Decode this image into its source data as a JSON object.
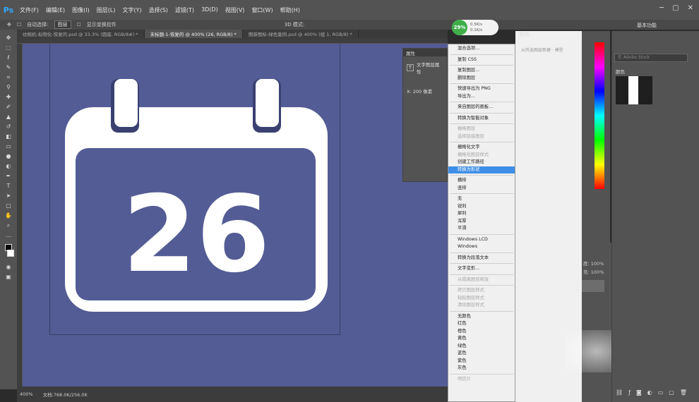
{
  "app": {
    "logo": "Ps"
  },
  "menu": [
    "文件(F)",
    "编辑(E)",
    "图像(I)",
    "图层(L)",
    "文字(Y)",
    "选择(S)",
    "滤镜(T)",
    "3D(D)",
    "视图(V)",
    "窗口(W)",
    "帮助(H)"
  ],
  "options": {
    "auto_select_label": "自动选择:",
    "auto_select_value": "图层",
    "transform_label": "显示变换控件",
    "mode_3d_label": "3D 模式:"
  },
  "workspace": {
    "label": "基本功能"
  },
  "tabs": [
    {
      "label": "纹蜿机-拟物化-恢复的.psd @ 33.3% (圆座, RGB/8#) *"
    },
    {
      "label": "未标题-1-恢复的 @ 400% (26, RGB/8) *"
    },
    {
      "label": "图新图标-绿色案例.psd @ 400% (组 1, RGB/8) *"
    }
  ],
  "status": {
    "zoom": "400%",
    "doc": "文档:768.0K/256.0K"
  },
  "properties": {
    "title": "属性",
    "type_label": "文字图层属性",
    "x_label": "X:",
    "x_value": "200 像素"
  },
  "perf": {
    "percent": "29%",
    "up": "0.5K/s",
    "down": "0.1K/s"
  },
  "artwork": {
    "date_number": "26"
  },
  "context_menu": {
    "items": [
      {
        "label": "混合选项...",
        "disabled": false
      },
      {
        "sep": true
      },
      {
        "label": "复制 CSS",
        "disabled": false
      },
      {
        "sep": true
      },
      {
        "label": "复制图层...",
        "disabled": false
      },
      {
        "label": "删除图层",
        "disabled": false
      },
      {
        "sep": true
      },
      {
        "label": "快速导出为 PNG",
        "disabled": false
      },
      {
        "label": "导出为...",
        "disabled": false
      },
      {
        "sep": true
      },
      {
        "label": "来自图层的画板...",
        "disabled": false
      },
      {
        "sep": true
      },
      {
        "label": "转换为智能对象",
        "disabled": false
      },
      {
        "sep": true
      },
      {
        "label": "栅格图层",
        "disabled": true
      },
      {
        "label": "选择链接图层",
        "disabled": true
      },
      {
        "sep": true
      },
      {
        "label": "栅格化文字",
        "disabled": false
      },
      {
        "label": "栅格化图层样式",
        "disabled": true
      },
      {
        "label": "创建工作路径",
        "disabled": false
      },
      {
        "label": "转换为形状",
        "disabled": false,
        "highlighted": true
      },
      {
        "sep": true
      },
      {
        "label": "横排",
        "disabled": false
      },
      {
        "label": "竖排",
        "disabled": false
      },
      {
        "sep": true
      },
      {
        "label": "无",
        "disabled": false
      },
      {
        "label": "锐利",
        "disabled": false
      },
      {
        "label": "犀利",
        "disabled": false
      },
      {
        "label": "浑厚",
        "disabled": false
      },
      {
        "label": "平滑",
        "disabled": false
      },
      {
        "sep": true
      },
      {
        "label": "Windows LCD",
        "disabled": false
      },
      {
        "label": "Windows",
        "disabled": false
      },
      {
        "sep": true
      },
      {
        "label": "转换为段落文本",
        "disabled": false
      },
      {
        "sep": true
      },
      {
        "label": "文字变形...",
        "disabled": false
      },
      {
        "sep": true
      },
      {
        "label": "从隔离图层释放",
        "disabled": true
      },
      {
        "sep": true
      },
      {
        "label": "拷贝图层样式",
        "disabled": true
      },
      {
        "label": "粘贴图层样式",
        "disabled": true
      },
      {
        "label": "清除图层样式",
        "disabled": true
      },
      {
        "sep": true
      },
      {
        "label": "无颜色",
        "disabled": false
      },
      {
        "label": "红色",
        "disabled": false
      },
      {
        "label": "橙色",
        "disabled": false
      },
      {
        "label": "黄色",
        "disabled": false
      },
      {
        "label": "绿色",
        "disabled": false
      },
      {
        "label": "蓝色",
        "disabled": false
      },
      {
        "label": "紫色",
        "disabled": false
      },
      {
        "label": "灰色",
        "disabled": false
      },
      {
        "sep": true
      },
      {
        "label": "明信片",
        "disabled": true
      }
    ]
  },
  "panels": {
    "color_tab": "颜色",
    "behind_hint": "从所选图层新建 · 模型",
    "library_search": "在 Adobe Stock",
    "library_label": "颜色",
    "opacity_label": "度:",
    "opacity_value": "100%",
    "fill_label": "充:",
    "fill_value": "100%"
  },
  "colors": {
    "canvas": "#535c94",
    "artwork": "#ffffff",
    "highlight": "#3d8ee6",
    "perf": "#3fae49"
  }
}
